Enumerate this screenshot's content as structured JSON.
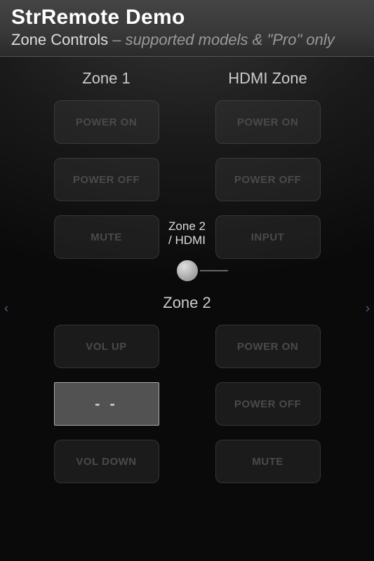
{
  "header": {
    "app_title": "StrRemote Demo",
    "subtitle_main": "Zone Controls",
    "subtitle_sep": " – ",
    "subtitle_note": "supported models & \"Pro\" only"
  },
  "zones": {
    "zone1": {
      "heading": "Zone 1",
      "buttons": {
        "power_on": "POWER ON",
        "power_off": "POWER OFF",
        "mute": "MUTE"
      }
    },
    "hdmi": {
      "heading": "HDMI Zone",
      "buttons": {
        "power_on": "POWER ON",
        "power_off": "POWER OFF",
        "input": "INPUT"
      }
    },
    "center": {
      "label_line1": "Zone 2",
      "label_line2": "/ HDMI"
    },
    "zone2": {
      "heading": "Zone 2",
      "left": {
        "vol_up": "VOL UP",
        "display": "- -",
        "vol_down": "VOL DOWN"
      },
      "right": {
        "power_on": "POWER ON",
        "power_off": "POWER OFF",
        "mute": "MUTE"
      }
    }
  },
  "nav": {
    "prev": "‹",
    "next": "›"
  }
}
